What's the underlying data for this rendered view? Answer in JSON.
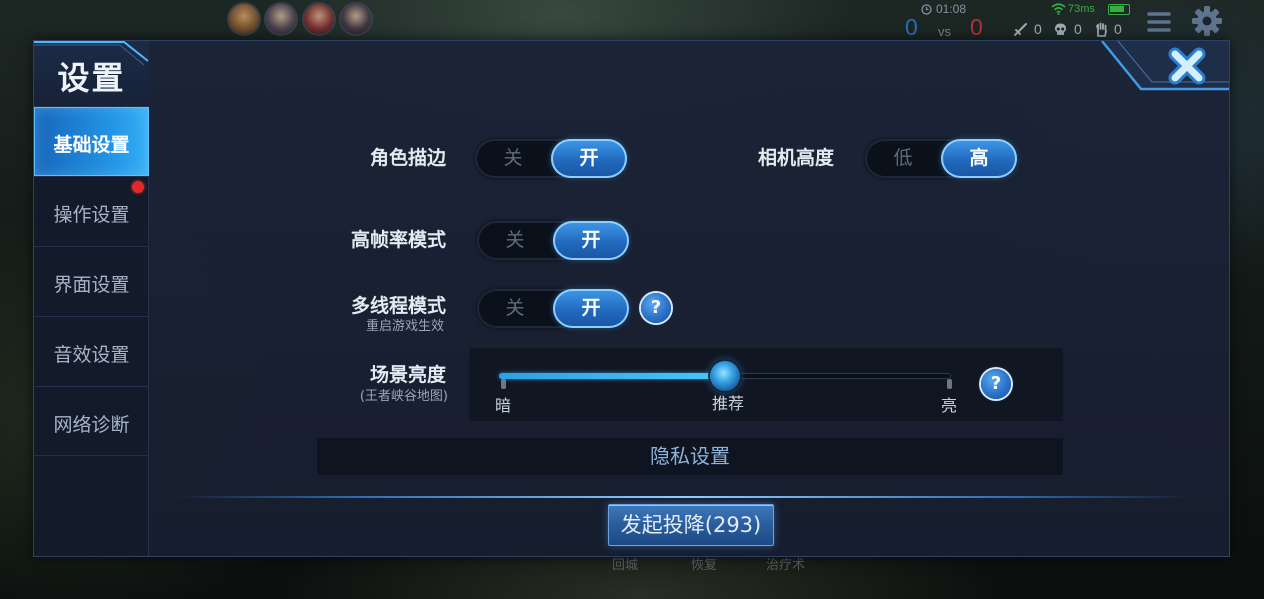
{
  "hud": {
    "timer": "01:08",
    "score_blue": "0",
    "vs": "vs",
    "score_red": "0",
    "ping": "73ms",
    "kills": "0",
    "deaths": "0",
    "assists": "0",
    "skill_labels": [
      "回城",
      "恢复",
      "治疗术"
    ],
    "colors": {
      "ping": "#3ed04a",
      "blue_team": "#2f80dc",
      "red_team": "#d9383a"
    }
  },
  "settings": {
    "title": "设置",
    "tabs": [
      {
        "label": "基础设置",
        "active": true,
        "badge": false
      },
      {
        "label": "操作设置",
        "active": false,
        "badge": true
      },
      {
        "label": "界面设置",
        "active": false,
        "badge": false
      },
      {
        "label": "音效设置",
        "active": false,
        "badge": false
      },
      {
        "label": "网络诊断",
        "active": false,
        "badge": false
      }
    ],
    "outline": {
      "label": "角色描边",
      "off": "关",
      "on": "开",
      "enabled": true
    },
    "camera_height": {
      "label": "相机高度",
      "low": "低",
      "high": "高",
      "is_high": true
    },
    "high_fps": {
      "label": "高帧率模式",
      "off": "关",
      "on": "开",
      "enabled": true
    },
    "multithread": {
      "label": "多线程模式",
      "note": "重启游戏生效",
      "off": "关",
      "on": "开",
      "enabled": true,
      "help": "?"
    },
    "brightness": {
      "label": "场景亮度",
      "note": "(王者峡谷地图)",
      "min_label": "暗",
      "mid_label": "推荐",
      "max_label": "亮",
      "value": 0.5,
      "help": "?"
    },
    "privacy_header": "隐私设置",
    "surrender_button": "发起投降(293)",
    "colors": {
      "accent": "#2496e6",
      "badge": "#e02a2a"
    }
  }
}
